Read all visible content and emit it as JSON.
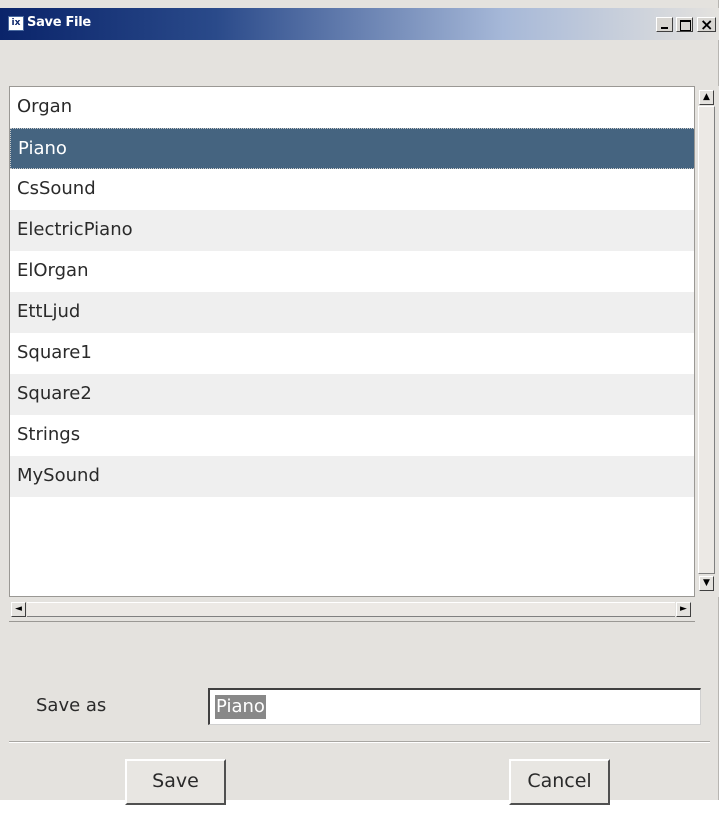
{
  "window": {
    "title": "Save File",
    "icon_label": "ix"
  },
  "list": {
    "items": [
      {
        "label": "Organ"
      },
      {
        "label": "Piano",
        "selected": true
      },
      {
        "label": "CsSound"
      },
      {
        "label": "ElectricPiano"
      },
      {
        "label": "ElOrgan"
      },
      {
        "label": "EttLjud"
      },
      {
        "label": "Square1"
      },
      {
        "label": "Square2"
      },
      {
        "label": "Strings"
      },
      {
        "label": "MySound"
      }
    ]
  },
  "scrollbars": {
    "up_icon": "▲",
    "down_icon": "▼",
    "left_icon": "◄",
    "right_icon": "►"
  },
  "save_as": {
    "label": "Save as",
    "value": "Piano"
  },
  "buttons": {
    "save_label": "Save",
    "cancel_label": "Cancel"
  },
  "colors": {
    "selection": "#456480",
    "title_bar": "#0a246a"
  }
}
